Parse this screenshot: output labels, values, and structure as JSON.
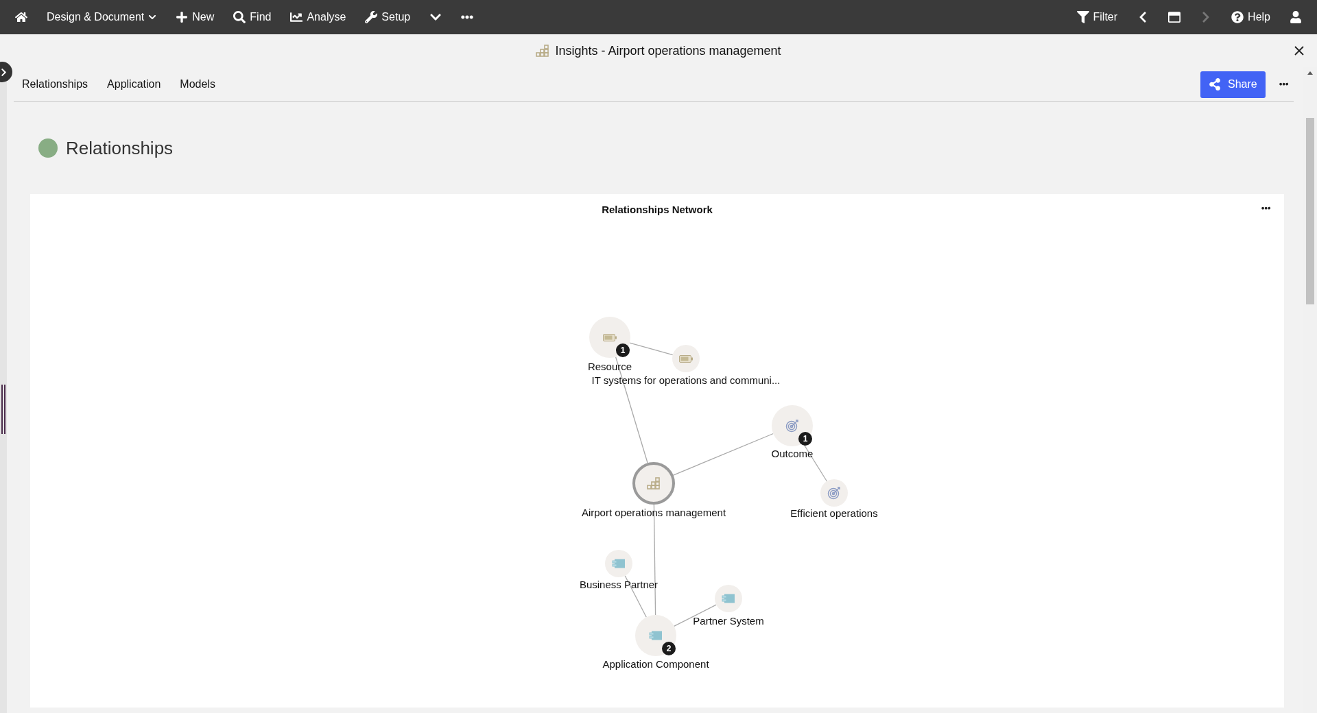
{
  "top_bar": {
    "menu": [
      {
        "kind": "home"
      },
      {
        "kind": "design",
        "label": "Design & Document"
      },
      {
        "kind": "new",
        "label": "New"
      },
      {
        "kind": "find",
        "label": "Find"
      },
      {
        "kind": "analyse",
        "label": "Analyse"
      },
      {
        "kind": "setup",
        "label": "Setup"
      },
      {
        "kind": "caret"
      },
      {
        "kind": "more"
      }
    ],
    "right": [
      {
        "kind": "filter",
        "label": "Filter",
        "disabled": false
      },
      {
        "kind": "back",
        "disabled": false
      },
      {
        "kind": "window",
        "disabled": false
      },
      {
        "kind": "forward",
        "disabled": true
      },
      {
        "kind": "help",
        "label": "Help",
        "disabled": false
      },
      {
        "kind": "user",
        "disabled": false
      }
    ]
  },
  "title": "Insights - Airport operations management",
  "tabs": [
    {
      "label": "Relationships"
    },
    {
      "label": "Application"
    },
    {
      "label": "Models"
    }
  ],
  "share_button": "Share",
  "section": {
    "title": "Relationships"
  },
  "card": {
    "title": "Relationships Network",
    "network": {
      "label": "Airport operations management",
      "kind": "capability",
      "children": [
        {
          "label": "Resource",
          "kind": "resource",
          "badge": "1",
          "children": [
            {
              "label": "IT systems for operations and communi...",
              "kind": "resource"
            }
          ]
        },
        {
          "label": "Outcome",
          "kind": "outcome",
          "badge": "1",
          "children": [
            {
              "label": "Efficient operations",
              "kind": "outcome"
            }
          ]
        },
        {
          "label": "Application Component",
          "kind": "component",
          "badge": "2",
          "children": [
            {
              "label": "Business Partner",
              "kind": "component"
            },
            {
              "label": "Partner System",
              "kind": "component"
            }
          ]
        }
      ]
    }
  }
}
